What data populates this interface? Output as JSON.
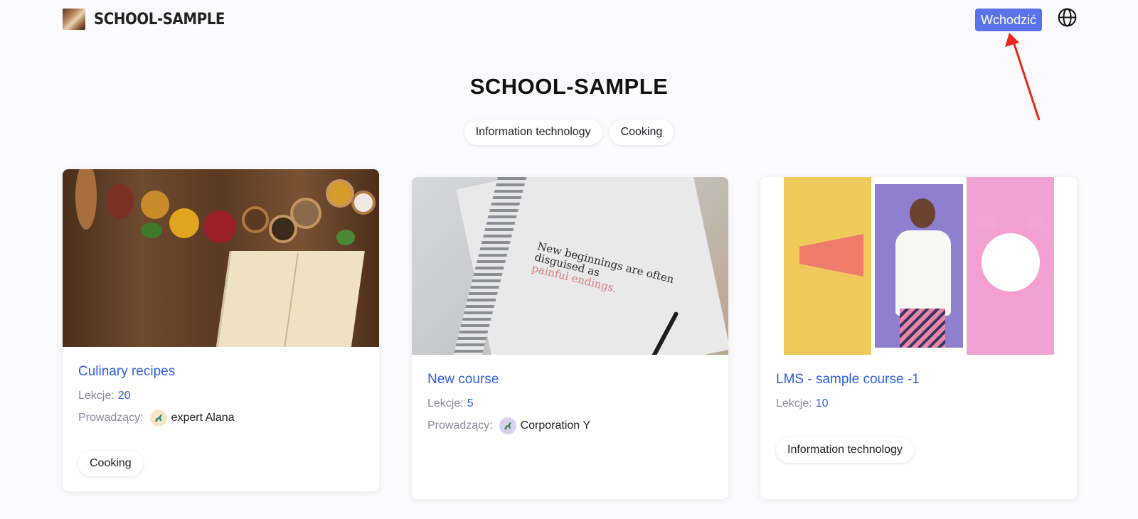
{
  "header": {
    "brand": "SCHOOL-SAMPLE",
    "login_label": "Wchodzić",
    "language_icon": "globe-icon"
  },
  "site_title": "SCHOOL-SAMPLE",
  "categories": [
    "Information technology",
    "Cooking"
  ],
  "colors": {
    "accent": "#2e5fe0",
    "login_button": "#5b73e8",
    "annotation_arrow": "#e8281c"
  },
  "courses": [
    {
      "title": "Culinary recipes",
      "lessons_label": "Lekcje:",
      "lessons": "20",
      "teacher_label": "Prowadzący:",
      "teacher": "expert Alana",
      "tag": "Cooking"
    },
    {
      "title": "New course",
      "lessons_label": "Lekcje:",
      "lessons": "5",
      "teacher_label": "Prowadzący:",
      "teacher": "Corporation Y",
      "image_text_1": "New beginnings are often",
      "image_text_2": "disguised as",
      "image_text_3": "painful endings."
    },
    {
      "title": "LMS - sample course -1",
      "lessons_label": "Lekcje:",
      "lessons": "10",
      "tag": "Information technology"
    }
  ]
}
